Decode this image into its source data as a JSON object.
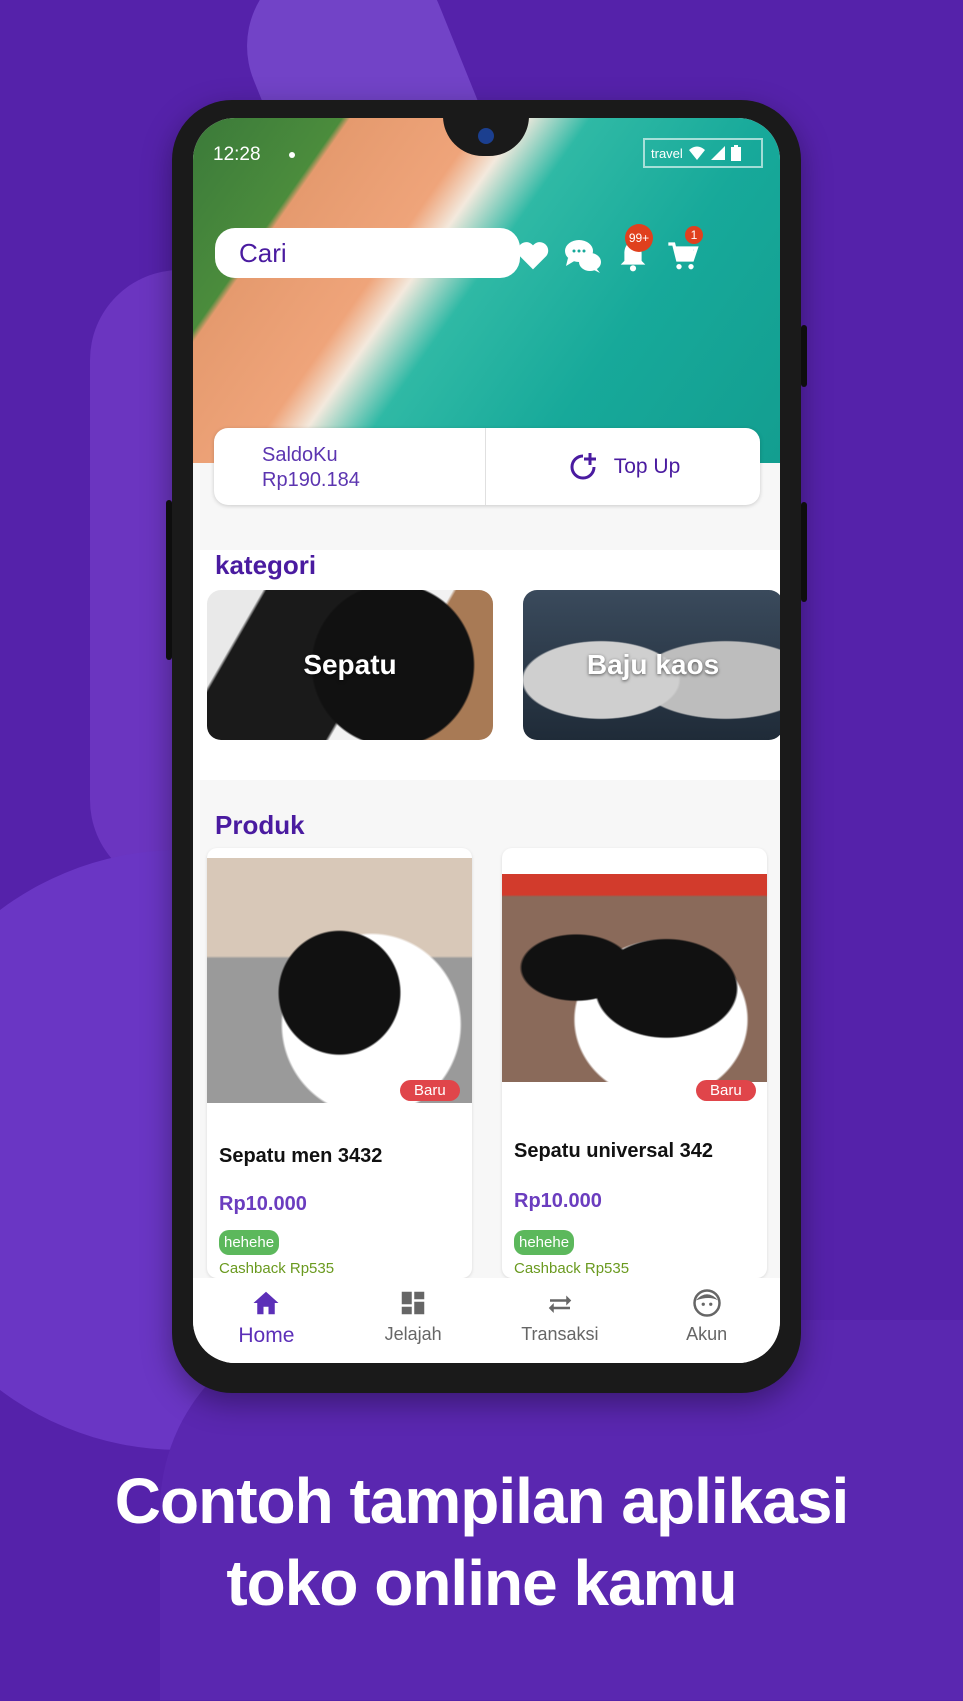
{
  "status_bar": {
    "time": "12:28",
    "right_label": "travel"
  },
  "header": {
    "search_placeholder": "Cari",
    "icons": [
      "heart-icon",
      "chat-icon",
      "bell-icon",
      "cart-icon"
    ],
    "notification_badge": "99+",
    "cart_badge": "1"
  },
  "balance": {
    "label": "SaldoKu",
    "amount": "Rp190.184",
    "topup_label": "Top Up"
  },
  "categories": {
    "title": "kategori",
    "items": [
      {
        "label": "Sepatu"
      },
      {
        "label": "Baju kaos"
      }
    ]
  },
  "products": {
    "title": "Produk",
    "items": [
      {
        "name": "Sepatu men 3432",
        "price": "Rp10.000",
        "tag": "Baru",
        "chip": "hehehe",
        "cashback": "Cashback Rp535"
      },
      {
        "name": "Sepatu universal 342",
        "price": "Rp10.000",
        "tag": "Baru",
        "chip": "hehehe",
        "cashback": "Cashback Rp535"
      }
    ]
  },
  "bottom_nav": [
    {
      "label": "Home",
      "icon": "home-icon",
      "active": true
    },
    {
      "label": "Jelajah",
      "icon": "dashboard-icon",
      "active": false
    },
    {
      "label": "Transaksi",
      "icon": "swap-icon",
      "active": false
    },
    {
      "label": "Akun",
      "icon": "face-icon",
      "active": false
    }
  ],
  "caption": {
    "line1": "Contoh tampilan aplikasi",
    "line2": "toko online kamu"
  },
  "colors": {
    "background": "#5522aa",
    "accent": "#4a1ba0",
    "badge": "#e0401e",
    "tag_new": "#e0454a",
    "chip": "#5cb85c",
    "cashback": "#6a9a1f"
  }
}
